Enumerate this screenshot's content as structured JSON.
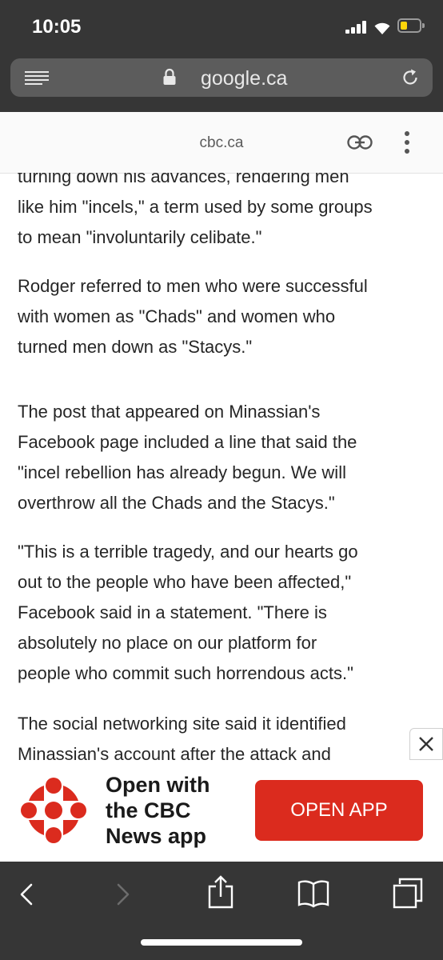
{
  "status_bar": {
    "time": "10:05"
  },
  "browser": {
    "url": "google.ca"
  },
  "site_header": {
    "site": "cbc.ca"
  },
  "article": {
    "paragraphs": [
      {
        "lines": [
          "turning down his advances, rendering men",
          "like him \"incels,\" a term used by some groups",
          "to mean \"involuntarily celibate.\""
        ]
      },
      {
        "lines": [
          "Rodger referred to men who were successful",
          "with women as \"Chads\" and women who",
          "turned men down as \"Stacys.\""
        ]
      },
      {
        "lines": [
          "The post that appeared on Minassian's",
          "Facebook page included a line that said the",
          "\"incel rebellion has already begun. We will",
          "overthrow all the Chads and the Stacys.\""
        ]
      },
      {
        "lines": [
          "\"This is a terrible tragedy, and our hearts go",
          "out to the people who have been affected,\"",
          "Facebook said in a statement. \"There is",
          "absolutely no place on our platform for",
          "people who commit such horrendous acts.\""
        ]
      },
      {
        "lines": [
          "The social networking site said it identified",
          "Minassian's account after the attack and"
        ]
      }
    ]
  },
  "app_banner": {
    "message_lines": [
      "Open with",
      "the CBC",
      "News app"
    ],
    "button_label": "OPEN APP"
  },
  "colors": {
    "chrome": "#363636",
    "accent": "#db2b1e",
    "battery": "#ffd60a"
  }
}
